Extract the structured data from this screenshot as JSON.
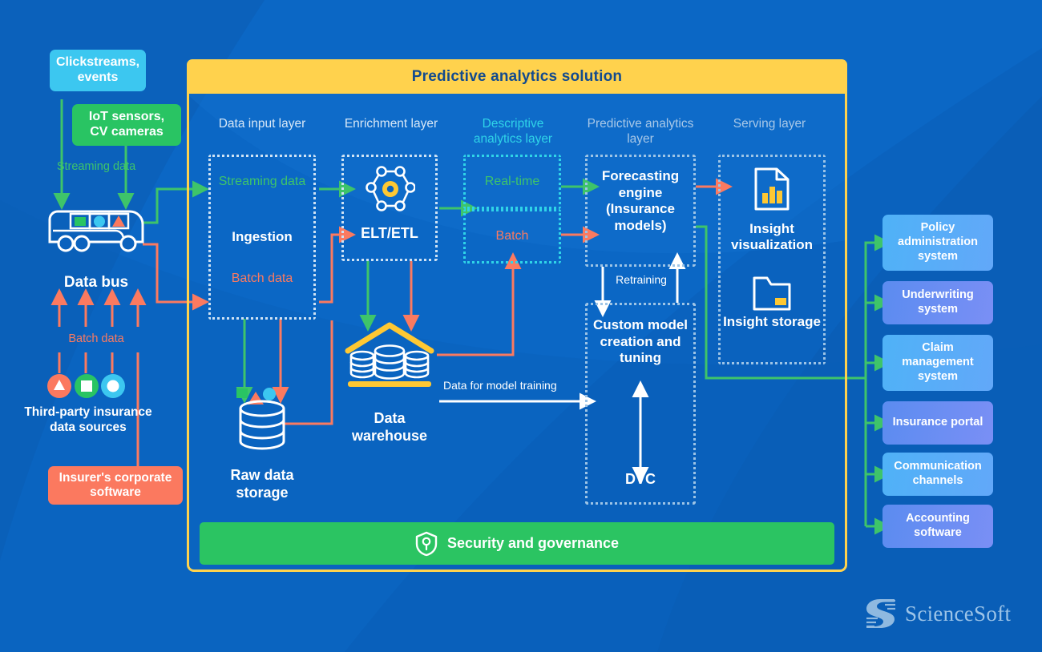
{
  "diagram": {
    "title": "Predictive analytics solution",
    "background_color": "#0a62be",
    "accent_yellow": "#ffd24d",
    "accent_green": "#2bc462",
    "accent_red": "#fb795f",
    "accent_cyan": "#3cc7f0"
  },
  "sources": {
    "clickstreams": "Clickstreams, events",
    "iot": "IoT sensors, CV cameras",
    "streaming_label": "Streaming data",
    "data_bus": "Data bus",
    "batch_label": "Batch data",
    "third_party": "Third-party insurance data sources",
    "insurer_software": "Insurer's corporate software"
  },
  "layers": [
    {
      "name": "Data input layer",
      "color": "#d8e8f7"
    },
    {
      "name": "Enrichment layer",
      "color": "#d8e8f7"
    },
    {
      "name": "Descriptive analytics layer",
      "color": "#2fd4e8"
    },
    {
      "name": "Predictive analytics layer",
      "color": "#a8c8e8"
    },
    {
      "name": "Serving layer",
      "color": "#a8c8e8"
    }
  ],
  "data_input": {
    "streaming": "Streaming data",
    "ingestion": "Ingestion",
    "batch": "Batch data",
    "raw_storage": "Raw data storage"
  },
  "enrichment": {
    "etl": "ELT/ETL",
    "warehouse": "Data warehouse"
  },
  "descriptive": {
    "realtime": "Real-time",
    "batch": "Batch"
  },
  "predictive": {
    "forecasting": "Forecasting engine (Insurance models)",
    "retraining": "Retraining",
    "custom_model": "Custom model creation and tuning",
    "dvc": "DVC",
    "training_data": "Data for model training"
  },
  "serving": {
    "insight_visualization": "Insight visualization",
    "insight_storage": "Insight storage"
  },
  "security": {
    "label": "Security and governance",
    "icon": "shield-lock-icon"
  },
  "outputs": [
    {
      "label": "Policy administration system",
      "style": "a"
    },
    {
      "label": "Underwriting system",
      "style": "b"
    },
    {
      "label": "Claim management system",
      "style": "a"
    },
    {
      "label": "Insurance portal",
      "style": "b"
    },
    {
      "label": "Communication channels",
      "style": "a"
    },
    {
      "label": "Accounting software",
      "style": "b"
    }
  ],
  "brand": {
    "name": "ScienceSoft"
  }
}
